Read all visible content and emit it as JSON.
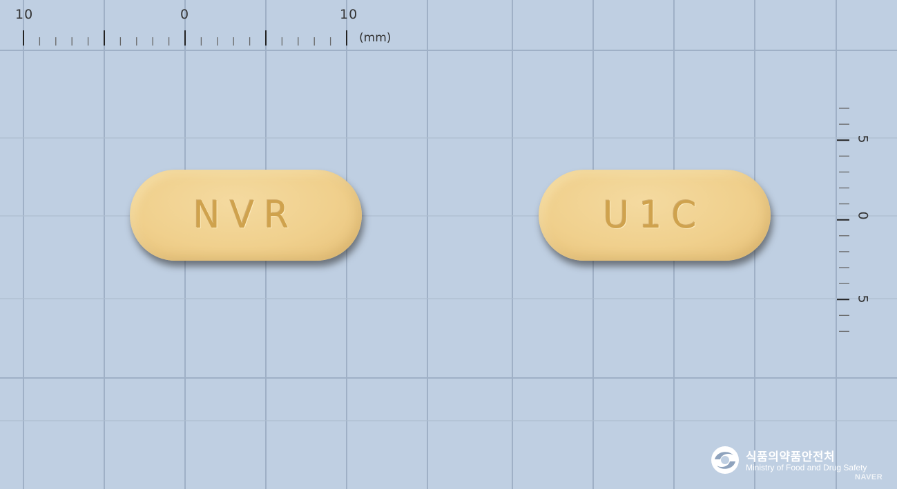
{
  "ruler_top": {
    "labels": [
      "10",
      "0",
      "10"
    ],
    "unit": "(mm)"
  },
  "ruler_right": {
    "labels": [
      "5",
      "0",
      "5"
    ]
  },
  "tablets": [
    {
      "imprint": "NVR"
    },
    {
      "imprint": "U1C"
    }
  ],
  "watermark": {
    "korean": "식품의약품안전처",
    "english": "Ministry of Food and Drug Safety",
    "naver": "NAVER"
  },
  "colors": {
    "background": "#bfcfe2",
    "grid_line": "#9fb0c6",
    "tablet": "#f0d08d",
    "imprint": "#cfa24d"
  }
}
